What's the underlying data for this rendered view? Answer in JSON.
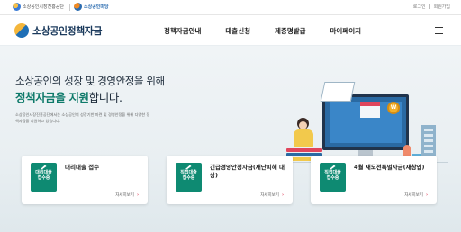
{
  "topbar": {
    "org1": "소상공인시장진흥공단",
    "org2": "소상공인마당",
    "login": "로그인",
    "signup": "회원가입"
  },
  "header": {
    "logo_text": "소상공인정책자금",
    "nav": [
      "정책자금안내",
      "대출신청",
      "제증명발급",
      "마이페이지"
    ]
  },
  "hero": {
    "title_line1": "소상공인의 성장 및 경영안정을 위해",
    "title_line2_highlight": "정책자금을 지원",
    "title_line2_rest": "합니다.",
    "description": "소상공인시장진흥공단에서는 소상공인의 성장기반 마련 및 경영안정을 위해 다양한 정책자금을 지원하고 있습니다."
  },
  "illustration": {
    "coin_label": "W"
  },
  "cards": [
    {
      "badge": "대리대출\n접수중",
      "title": "대리대출 접수",
      "more": "자세히보기"
    },
    {
      "badge": "직접대출\n접수중",
      "title": "긴급경영안정자금(재난피해 대상)",
      "more": "자세히보기"
    },
    {
      "badge": "직접대출\n접수중",
      "title": "4월 재도전특별자금(재창업)",
      "more": "자세히보기"
    }
  ],
  "colors": {
    "brand_green": "#0e8a72",
    "brand_navy": "#1b3a5c",
    "accent_red": "#e0455c"
  }
}
